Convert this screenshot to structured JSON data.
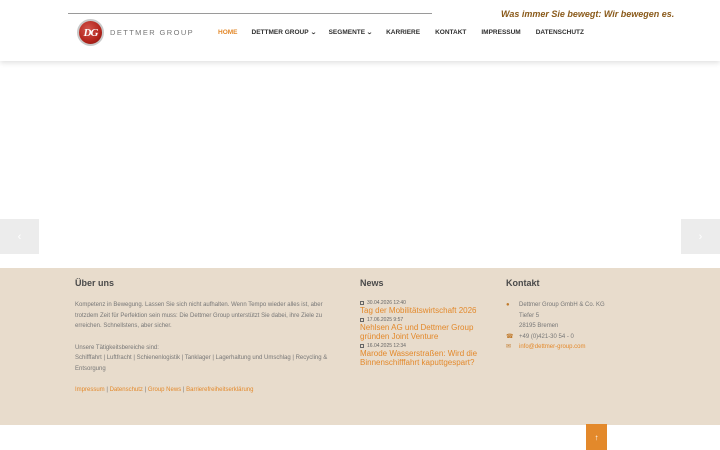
{
  "header": {
    "slogan": "Was immer Sie bewegt: Wir bewegen es.",
    "logo": {
      "mark": "DG",
      "text": "DETTMER GROUP"
    },
    "nav": [
      {
        "label": "HOME",
        "active": true,
        "dropdown": false
      },
      {
        "label": "DETTMER GROUP",
        "active": false,
        "dropdown": true
      },
      {
        "label": "SEGMENTE",
        "active": false,
        "dropdown": true
      },
      {
        "label": "KARRIERE",
        "active": false,
        "dropdown": false
      },
      {
        "label": "KONTAKT",
        "active": false,
        "dropdown": false
      },
      {
        "label": "IMPRESSUM",
        "active": false,
        "dropdown": false
      },
      {
        "label": "DATENSCHUTZ",
        "active": false,
        "dropdown": false
      }
    ]
  },
  "slider": {
    "prev_icon": "chevron-left-icon",
    "next_icon": "chevron-right-icon",
    "prev_glyph": "‹",
    "next_glyph": "›"
  },
  "footer": {
    "about": {
      "heading": "Über uns",
      "paragraph": "Kompetenz in Bewegung. Lassen Sie sich nicht aufhalten. Wenn Tempo wieder alles ist, aber trotzdem Zeit für Perfektion sein muss: Die Dettmer Group unterstützt Sie dabei, ihre Ziele zu erreichen. Schnellstens, aber sicher.",
      "areas_intro": "Unsere Tätigkeitsbereiche sind:",
      "areas": "Schifffahrt | Luftfracht | Schienenlogistik | Tanklager | Lagerhaltung und Umschlag | Recycling & Entsorgung",
      "links": [
        "Impressum",
        "Datenschutz",
        "Group News",
        "Barrierefreiheitserklärung"
      ],
      "link_separator": " | "
    },
    "news": {
      "heading": "News",
      "items": [
        {
          "date": "30.04.2026 12:40",
          "title": "Tag der Mobilitätswirtschaft 2026"
        },
        {
          "date": "17.06.2025 9:57",
          "title": "Nehlsen AG und Dettmer Group gründen Joint Venture"
        },
        {
          "date": "16.04.2025 12:34",
          "title": "Marode Wasserstraßen: Wird die Binnenschifffahrt kaputtgespart?"
        }
      ]
    },
    "contact": {
      "heading": "Kontakt",
      "address_lines": [
        "Dettmer Group GmbH & Co. KG",
        "Tiefer 5",
        "28195 Bremen"
      ],
      "phone": "+49 (0)421-30 54 - 0",
      "email": "info@dettmer-group.com",
      "icons": {
        "address": "map-marker-icon",
        "phone": "phone-icon",
        "email": "envelope-icon"
      }
    }
  },
  "back_to_top": {
    "icon": "arrow-up-icon",
    "glyph": "↑"
  },
  "colors": {
    "accent": "#e3892b",
    "footer_bg": "#e8dccc",
    "slogan": "#8a5a1a"
  }
}
